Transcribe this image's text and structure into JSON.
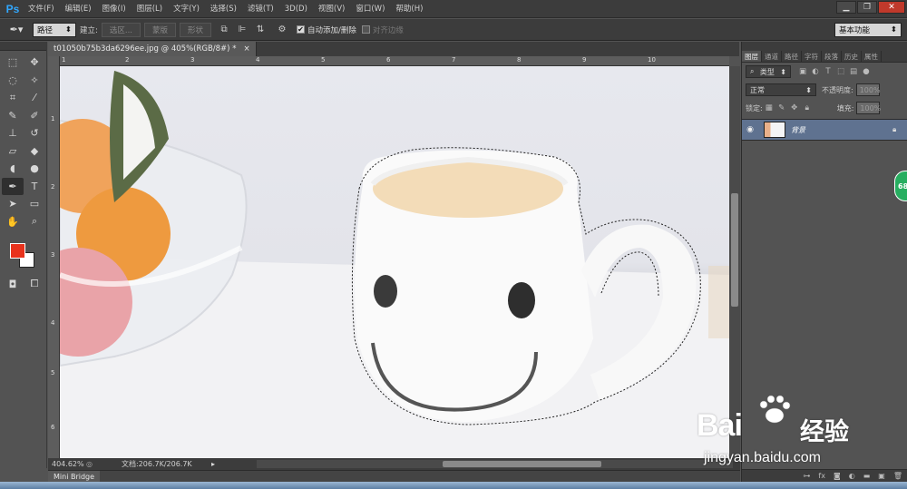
{
  "app": {
    "logo": "Ps"
  },
  "menu": [
    "文件(F)",
    "编辑(E)",
    "图像(I)",
    "图层(L)",
    "文字(Y)",
    "选择(S)",
    "滤镜(T)",
    "3D(D)",
    "视图(V)",
    "窗口(W)",
    "帮助(H)"
  ],
  "window_controls": {
    "minimize": "▁",
    "restore": "❐",
    "close": "✕"
  },
  "options": {
    "mode_value": "路径",
    "build_label": "建立:",
    "buttons": [
      "选区...",
      "蒙版",
      "形状"
    ],
    "auto_add_delete": "自动添加/删除",
    "auto_add_delete_checked": true,
    "align_edges": "对齐边缘",
    "align_edges_checked": false,
    "workspace": "基本功能"
  },
  "document": {
    "tab_title": "t01050b75b3da6296ee.jpg @ 405%(RGB/8#) *",
    "tab_close": "×"
  },
  "rulers": {
    "horizontal": [
      "1",
      "2",
      "3",
      "4",
      "5",
      "6",
      "7",
      "8",
      "9",
      "10"
    ],
    "vertical": [
      "1",
      "2",
      "3",
      "4",
      "5",
      "6"
    ]
  },
  "status": {
    "zoom": "404.62%",
    "doc_info": "文档:206.7K/206.7K"
  },
  "mini_bridge": "Mini Bridge",
  "layers_panel": {
    "tabs": [
      "图层",
      "通道",
      "路径",
      "字符",
      "段落",
      "历史",
      "属性"
    ],
    "filter_kind": "类型",
    "blend_mode": "正常",
    "opacity_label": "不透明度:",
    "opacity_value": "100%",
    "lock_label": "锁定:",
    "fill_label": "填充:",
    "fill_value": "100%",
    "layer_name": "背景"
  },
  "side_badge": "68",
  "watermark": {
    "brand": "Bai",
    "brand_suffix": "经验",
    "url": "jingyan.baidu.com"
  },
  "colors": {
    "foreground": "#e8321c",
    "background": "#ffffff",
    "selected_layer": "#5f7290"
  }
}
